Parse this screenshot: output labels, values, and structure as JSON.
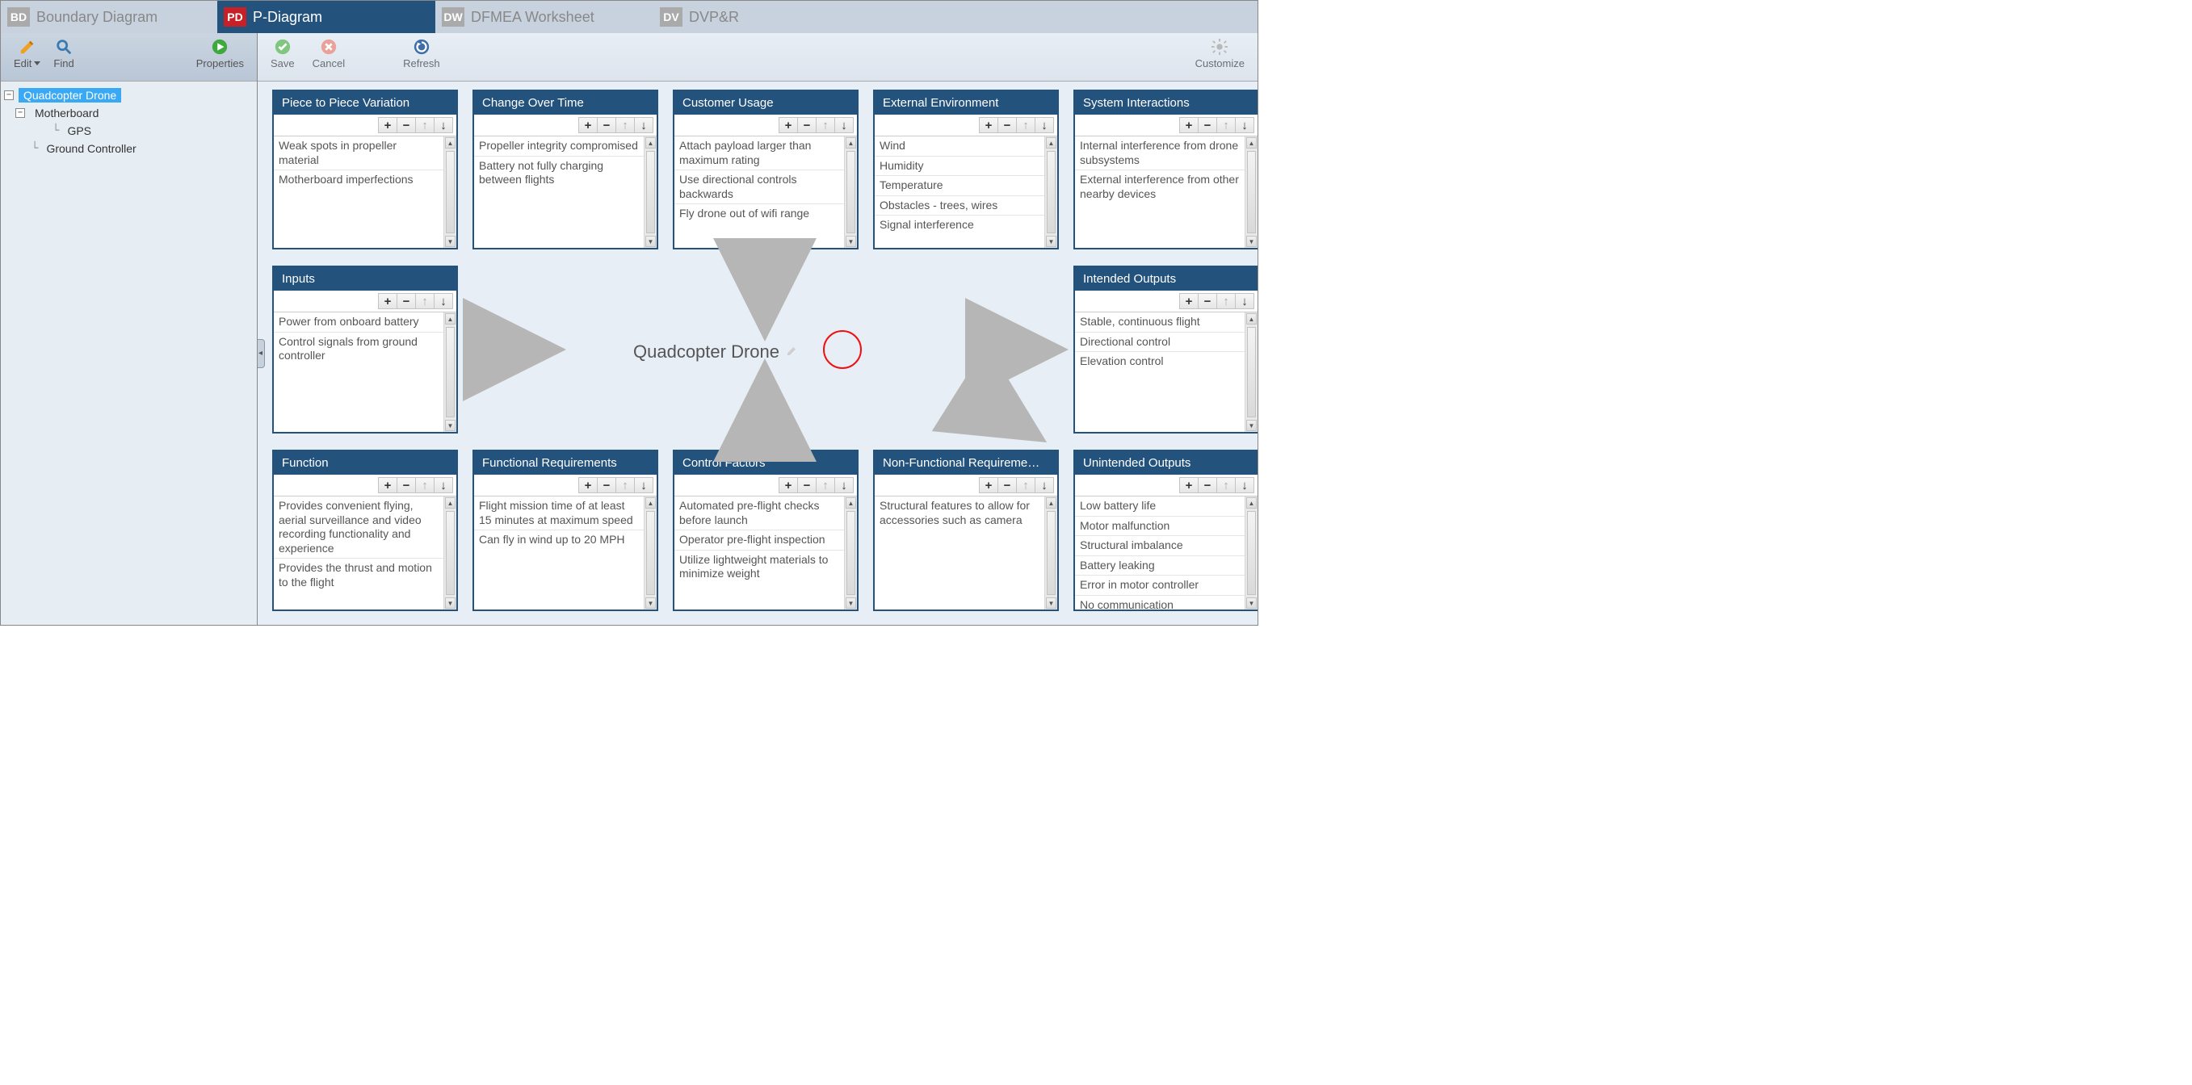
{
  "tabs": [
    {
      "badge": "BD",
      "label": "Boundary Diagram"
    },
    {
      "badge": "PD",
      "label": "P-Diagram"
    },
    {
      "badge": "DW",
      "label": "DFMEA Worksheet"
    },
    {
      "badge": "DV",
      "label": "DVP&R"
    }
  ],
  "sidebar_toolbar": {
    "edit": "Edit",
    "find": "Find",
    "properties": "Properties"
  },
  "main_toolbar": {
    "save": "Save",
    "cancel": "Cancel",
    "refresh": "Refresh",
    "customize": "Customize"
  },
  "tree": {
    "root": "Quadcopter Drone",
    "child1": "Motherboard",
    "grandchild1": "GPS",
    "child2": "Ground Controller"
  },
  "center_label": "Quadcopter Drone",
  "cards": {
    "piece": {
      "title": "Piece to Piece Variation",
      "items": [
        "Weak spots in propeller material",
        "Motherboard imperfections"
      ]
    },
    "change": {
      "title": "Change Over Time",
      "items": [
        "Propeller integrity compromised",
        "Battery not fully charging between flights"
      ]
    },
    "customer": {
      "title": "Customer Usage",
      "items": [
        "Attach payload larger than maximum rating",
        "Use directional controls backwards",
        "Fly drone out of wifi range"
      ]
    },
    "external": {
      "title": "External Environment",
      "items": [
        "Wind",
        "Humidity",
        "Temperature",
        "Obstacles - trees, wires",
        "Signal interference"
      ]
    },
    "sysint": {
      "title": "System Interactions",
      "items": [
        "Internal interference from drone subsystems",
        "External interference from other nearby devices"
      ]
    },
    "inputs": {
      "title": "Inputs",
      "items": [
        "Power from onboard battery",
        "Control signals from ground controller"
      ]
    },
    "intended": {
      "title": "Intended Outputs",
      "items": [
        "Stable, continuous flight",
        "Directional control",
        "Elevation control"
      ]
    },
    "function": {
      "title": "Function",
      "items": [
        "Provides convenient flying, aerial surveillance and video recording functionality and experience",
        "Provides the thrust and motion to the flight"
      ]
    },
    "funcreq": {
      "title": "Functional Requirements",
      "items": [
        "Flight mission time of at least 15 minutes at maximum speed",
        "Can fly in wind up to 20 MPH"
      ]
    },
    "control": {
      "title": "Control Factors",
      "items": [
        "Automated pre-flight checks before launch",
        "Operator pre-flight inspection",
        "Utilize lightweight materials to minimize weight"
      ]
    },
    "nonfunc": {
      "title": "Non-Functional Requireme…",
      "items": [
        "Structural features to allow for accessories such as camera"
      ]
    },
    "unintended": {
      "title": "Unintended Outputs",
      "items": [
        "Low battery life",
        "Motor malfunction",
        "Structural imbalance",
        "Battery leaking",
        "Error in motor controller",
        "No communication"
      ]
    }
  }
}
